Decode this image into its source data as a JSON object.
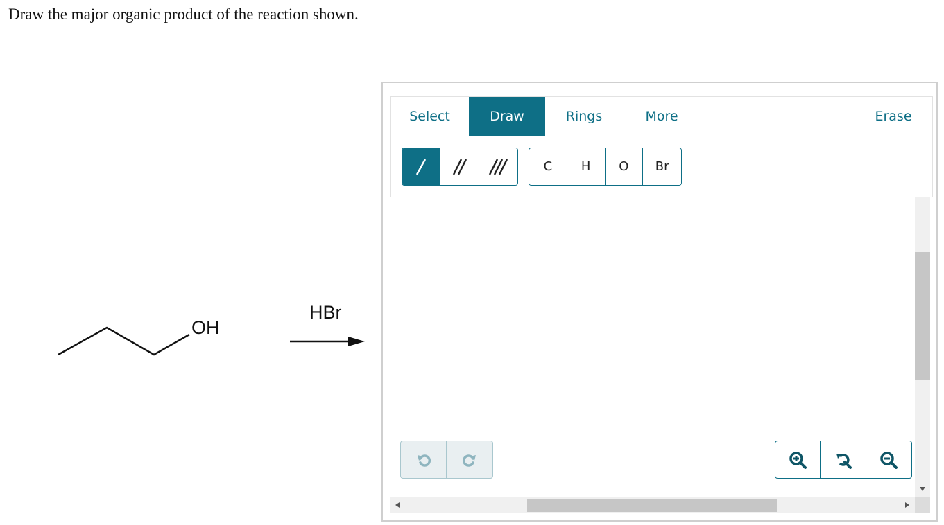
{
  "question": "Draw the major organic product of the reaction shown.",
  "reaction": {
    "substituent_label": "OH",
    "reagent": "HBr"
  },
  "editor": {
    "tabs": {
      "select": "Select",
      "draw": "Draw",
      "rings": "Rings",
      "more": "More",
      "erase": "Erase"
    },
    "active_tab": "Draw",
    "bond_tools": [
      "single-bond",
      "double-bond",
      "triple-bond"
    ],
    "active_bond": "single-bond",
    "atoms": [
      "C",
      "H",
      "O",
      "Br"
    ],
    "accent_color": "#0e6f86"
  }
}
